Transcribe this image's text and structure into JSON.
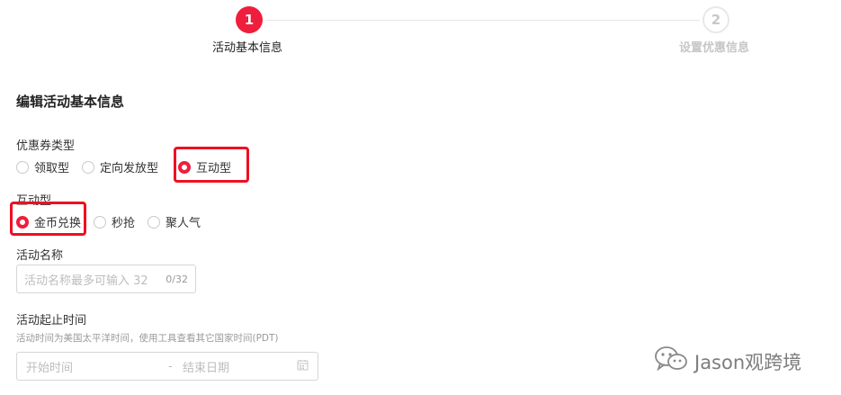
{
  "stepper": {
    "step1": {
      "number": "1",
      "label": "活动基本信息"
    },
    "step2": {
      "number": "2",
      "label": "设置优惠信息"
    }
  },
  "section_title": "编辑活动基本信息",
  "coupon_type": {
    "label": "优惠券类型",
    "options": [
      "领取型",
      "定向发放型",
      "互动型"
    ],
    "selected": "互动型"
  },
  "interactive_type": {
    "label": "互动型",
    "options": [
      "金币兑换",
      "秒抢",
      "聚人气"
    ],
    "selected": "金币兑换"
  },
  "activity_name": {
    "label": "活动名称",
    "placeholder": "活动名称最多可输入 32",
    "counter": "0/32"
  },
  "activity_time": {
    "label": "活动起止时间",
    "hint": "活动时间为美国太平洋时间，使用工具查看其它国家时间(PDT)",
    "start_placeholder": "开始时间",
    "separator": "-",
    "end_placeholder": "结束日期"
  },
  "watermark": {
    "text": "Jason观跨境"
  },
  "colors": {
    "accent": "#ee1e3c",
    "highlight": "#ee1020"
  }
}
